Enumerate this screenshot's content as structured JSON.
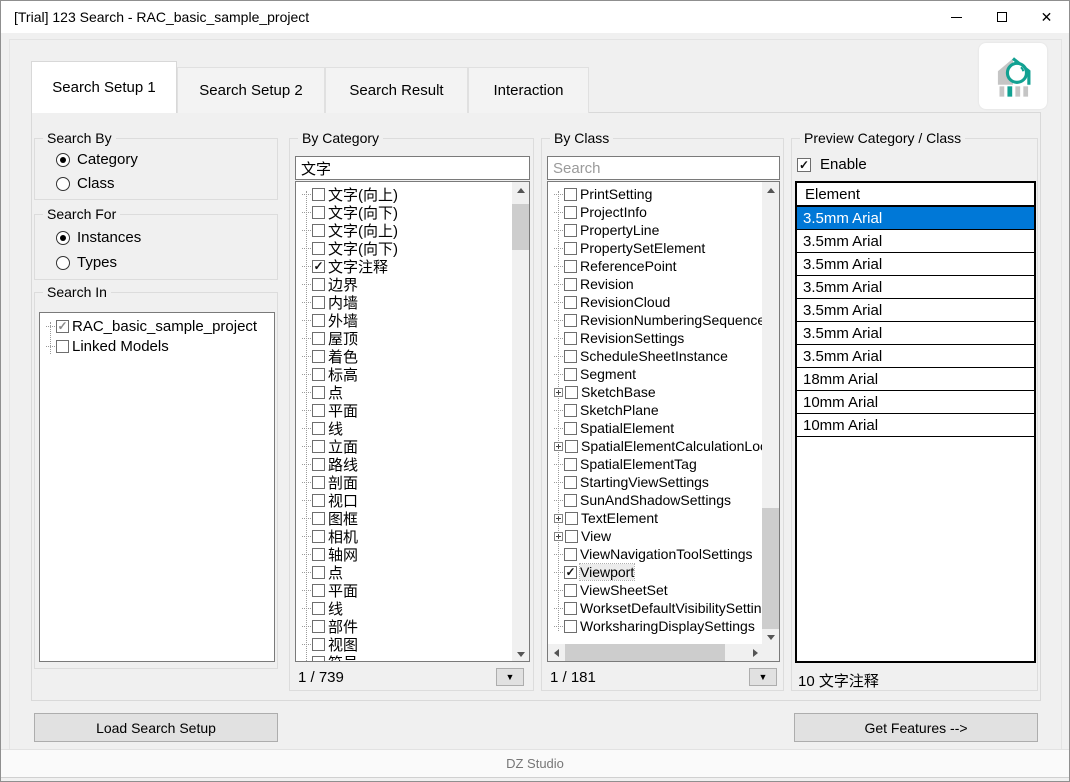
{
  "window": {
    "title": "[Trial] 123 Search - RAC_basic_sample_project",
    "controls": [
      "minimize",
      "maximize",
      "close"
    ]
  },
  "brand": {
    "teal": "#12a192",
    "gray": "#c5c5c5",
    "selection_blue": "#0078d7"
  },
  "icons": {
    "logo": "house-magnifier-logo"
  },
  "tabs": [
    {
      "label": "Search Setup 1",
      "active": true
    },
    {
      "label": "Search Setup 2",
      "active": false
    },
    {
      "label": "Search Result",
      "active": false
    },
    {
      "label": "Interaction",
      "active": false
    }
  ],
  "search_by": {
    "title": "Search By",
    "options": [
      {
        "label": "Category",
        "selected": true
      },
      {
        "label": "Class",
        "selected": false
      }
    ]
  },
  "search_for": {
    "title": "Search For",
    "options": [
      {
        "label": "Instances",
        "selected": true
      },
      {
        "label": "Types",
        "selected": false
      }
    ]
  },
  "search_in": {
    "title": "Search In",
    "items": [
      {
        "label": "RAC_basic_sample_project",
        "checked": true,
        "dimmed": true
      },
      {
        "label": "Linked Models",
        "checked": false
      }
    ]
  },
  "by_category": {
    "title": "By Category",
    "filter_value": "文字",
    "counter": "1 / 739",
    "items": [
      {
        "label": "文字(向上)",
        "checked": false
      },
      {
        "label": "文字(向下)",
        "checked": false
      },
      {
        "label": "文字(向上)",
        "checked": false
      },
      {
        "label": "文字(向下)",
        "checked": false
      },
      {
        "label": "文字注释",
        "checked": true
      },
      {
        "label": "边界",
        "checked": false
      },
      {
        "label": "内墙",
        "checked": false
      },
      {
        "label": "外墙",
        "checked": false
      },
      {
        "label": "屋顶",
        "checked": false
      },
      {
        "label": "着色",
        "checked": false
      },
      {
        "label": "标高",
        "checked": false
      },
      {
        "label": "点",
        "checked": false
      },
      {
        "label": "平面",
        "checked": false
      },
      {
        "label": "线",
        "checked": false
      },
      {
        "label": "立面",
        "checked": false
      },
      {
        "label": "路线",
        "checked": false
      },
      {
        "label": "剖面",
        "checked": false
      },
      {
        "label": "视口",
        "checked": false
      },
      {
        "label": "图框",
        "checked": false
      },
      {
        "label": "相机",
        "checked": false
      },
      {
        "label": "轴网",
        "checked": false
      },
      {
        "label": "点",
        "checked": false
      },
      {
        "label": "平面",
        "checked": false
      },
      {
        "label": "线",
        "checked": false
      },
      {
        "label": "部件",
        "checked": false
      },
      {
        "label": "视图",
        "checked": false
      },
      {
        "label": "符号",
        "checked": false
      }
    ]
  },
  "by_class": {
    "title": "By Class",
    "search_placeholder": "Search",
    "counter": "1 / 181",
    "items": [
      {
        "label": "PrintSetting",
        "checked": false
      },
      {
        "label": "ProjectInfo",
        "checked": false
      },
      {
        "label": "PropertyLine",
        "checked": false
      },
      {
        "label": "PropertySetElement",
        "checked": false
      },
      {
        "label": "ReferencePoint",
        "checked": false
      },
      {
        "label": "Revision",
        "checked": false
      },
      {
        "label": "RevisionCloud",
        "checked": false
      },
      {
        "label": "RevisionNumberingSequence",
        "checked": false
      },
      {
        "label": "RevisionSettings",
        "checked": false
      },
      {
        "label": "ScheduleSheetInstance",
        "checked": false
      },
      {
        "label": "Segment",
        "checked": false
      },
      {
        "label": "SketchBase",
        "checked": false,
        "expandable": true
      },
      {
        "label": "SketchPlane",
        "checked": false
      },
      {
        "label": "SpatialElement",
        "checked": false
      },
      {
        "label": "SpatialElementCalculationLoca",
        "checked": false,
        "expandable": true
      },
      {
        "label": "SpatialElementTag",
        "checked": false
      },
      {
        "label": "StartingViewSettings",
        "checked": false
      },
      {
        "label": "SunAndShadowSettings",
        "checked": false
      },
      {
        "label": "TextElement",
        "checked": false,
        "expandable": true
      },
      {
        "label": "View",
        "checked": false,
        "expandable": true
      },
      {
        "label": "ViewNavigationToolSettings",
        "checked": false
      },
      {
        "label": "Viewport",
        "checked": true,
        "focused": true
      },
      {
        "label": "ViewSheetSet",
        "checked": false
      },
      {
        "label": "WorksetDefaultVisibilitySetting",
        "checked": false
      },
      {
        "label": "WorksharingDisplaySettings",
        "checked": false
      }
    ]
  },
  "preview": {
    "title": "Preview Category / Class",
    "enable_label": "Enable",
    "enabled": true,
    "header": "Element",
    "rows": [
      {
        "label": "3.5mm Arial",
        "selected": true
      },
      {
        "label": "3.5mm Arial",
        "selected": false
      },
      {
        "label": "3.5mm Arial",
        "selected": false
      },
      {
        "label": "3.5mm Arial",
        "selected": false
      },
      {
        "label": "3.5mm Arial",
        "selected": false
      },
      {
        "label": "3.5mm Arial",
        "selected": false
      },
      {
        "label": "3.5mm Arial",
        "selected": false
      },
      {
        "label": "18mm Arial",
        "selected": false
      },
      {
        "label": "10mm Arial",
        "selected": false
      },
      {
        "label": "10mm Arial",
        "selected": false
      }
    ],
    "footer": "10 文字注释"
  },
  "buttons": {
    "load_label": "Load Search Setup",
    "get_features_label": "Get Features  -->"
  },
  "status": "DZ Studio"
}
